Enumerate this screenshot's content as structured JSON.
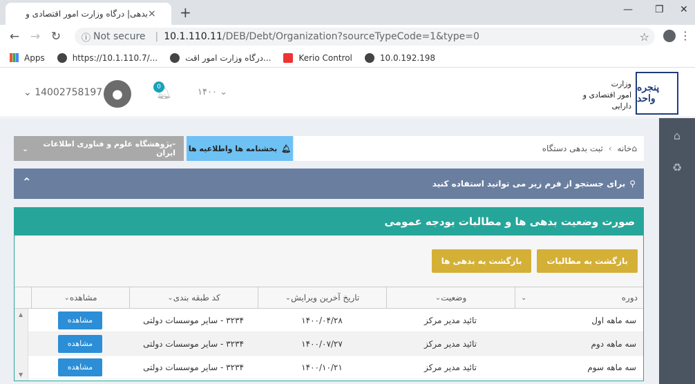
{
  "browser": {
    "tab_title": "بدهی| درگاه وزارت امور اقتصادی و",
    "tab_close": "×",
    "new_tab": "+",
    "not_secure": "Not secure",
    "url_host": "10.1.110.11",
    "url_path": "/DEB/Debt/Organization?sourceTypeCode=1&type=0",
    "bookmarks": [
      {
        "label": "Apps",
        "icon": "apps-grid-icon"
      },
      {
        "label": "https://10.1.110.7/...",
        "icon": "globe-icon"
      },
      {
        "label": "درگاه وزارت امور اقت...",
        "icon": "globe-icon"
      },
      {
        "label": "Kerio Control",
        "icon": "kerio-icon"
      },
      {
        "label": "10.0.192.198",
        "icon": "globe-icon"
      }
    ]
  },
  "header": {
    "logo_text_line1": "وزارت",
    "logo_text_line2": "امور اقتصادی و دارایی",
    "logo_mark": "پنجره واحد",
    "year": "۱۴۰۰",
    "notification_count": "0",
    "user_id": "14002758197"
  },
  "breadcrumb": {
    "home": "خانه",
    "current": "ثبت بدهی دستگاه"
  },
  "notice_button": "بخشنامه ها واطلاعیه ها",
  "org_select": "-پژوهشگاه علوم و فناوری اطلاعات ایران",
  "search_bar": "برای جستجو از فرم زیر می توانید استفاده کنید",
  "panel": {
    "title": "صورت وضعیت بدهی ها و مطالبات بودجه عمومی",
    "buttons": [
      "بازگشت به مطالبات",
      "بازگشت به بدهی ها"
    ]
  },
  "table": {
    "columns": [
      "دوره",
      "وضعیت",
      "تاریخ آخرین ویرایش",
      "کد طبقه بندی",
      "مشاهده"
    ],
    "rows": [
      {
        "period": "سه ماهه اول",
        "status": "تائید مدیر مرکز",
        "date": "۱۴۰۰/۰۴/۲۸",
        "code": "۳۲۳۴ - سایر موسسات دولتی",
        "action": "مشاهده"
      },
      {
        "period": "سه ماهه دوم",
        "status": "تائید مدیر مرکز",
        "date": "۱۴۰۰/۰۷/۲۷",
        "code": "۳۲۳۴ - سایر موسسات دولتی",
        "action": "مشاهده"
      },
      {
        "period": "سه ماهه سوم",
        "status": "تائید مدیر مرکز",
        "date": "۱۴۰۰/۱۰/۲۱",
        "code": "۳۲۳۴ - سایر موسسات دولتی",
        "action": "مشاهده"
      }
    ]
  }
}
